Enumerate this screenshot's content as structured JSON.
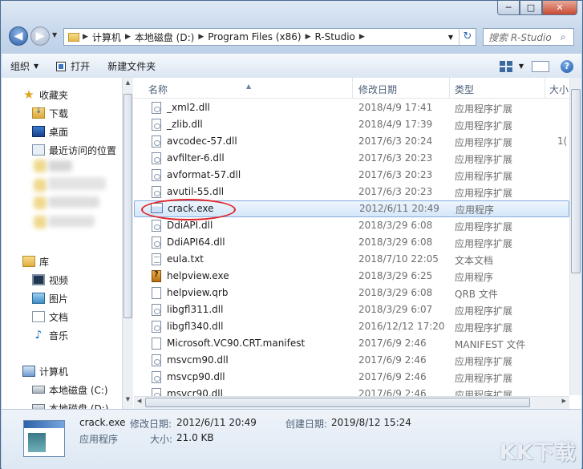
{
  "window": {
    "controls": [
      "─",
      "□",
      "✕"
    ]
  },
  "address": {
    "crumbs": [
      "计算机",
      "本地磁盘 (D:)",
      "Program Files (x86)",
      "R-Studio"
    ],
    "search_placeholder": "搜索 R-Studio"
  },
  "toolbar": {
    "organize": "组织",
    "open": "打开",
    "new_folder": "新建文件夹"
  },
  "nav": {
    "favorites": "收藏夹",
    "downloads": "下载",
    "desktop": "桌面",
    "recent": "最近访问的位置",
    "libraries": "库",
    "videos": "视频",
    "pictures": "图片",
    "documents": "文档",
    "music": "音乐",
    "computer": "计算机",
    "drive_c": "本地磁盘 (C:)",
    "drive_d": "本地磁盘 (D:)"
  },
  "columns": {
    "name": "名称",
    "modified": "修改日期",
    "type": "类型",
    "size": "大小"
  },
  "files": [
    {
      "name": "_xml2.dll",
      "date": "2018/4/9 17:41",
      "type": "应用程序扩展",
      "size": "",
      "icon": "dll-icon"
    },
    {
      "name": "_zlib.dll",
      "date": "2018/4/9 17:39",
      "type": "应用程序扩展",
      "size": "",
      "icon": "dll-icon"
    },
    {
      "name": "avcodec-57.dll",
      "date": "2017/6/3 20:24",
      "type": "应用程序扩展",
      "size": "1(",
      "icon": "dll-icon"
    },
    {
      "name": "avfilter-6.dll",
      "date": "2017/6/3 20:23",
      "type": "应用程序扩展",
      "size": "",
      "icon": "dll-icon"
    },
    {
      "name": "avformat-57.dll",
      "date": "2017/6/3 20:23",
      "type": "应用程序扩展",
      "size": "",
      "icon": "dll-icon"
    },
    {
      "name": "avutil-55.dll",
      "date": "2017/6/3 20:23",
      "type": "应用程序扩展",
      "size": "",
      "icon": "dll-icon"
    },
    {
      "name": "crack.exe",
      "date": "2012/6/11 20:49",
      "type": "应用程序",
      "size": "",
      "icon": "exe-icon"
    },
    {
      "name": "DdiAPI.dll",
      "date": "2018/3/29 6:08",
      "type": "应用程序扩展",
      "size": "",
      "icon": "dll-icon"
    },
    {
      "name": "DdiAPI64.dll",
      "date": "2018/3/29 6:08",
      "type": "应用程序扩展",
      "size": "",
      "icon": "dll-icon"
    },
    {
      "name": "eula.txt",
      "date": "2018/7/10 22:05",
      "type": "文本文档",
      "size": "",
      "icon": "txt-icon"
    },
    {
      "name": "helpview.exe",
      "date": "2018/3/29 6:25",
      "type": "应用程序",
      "size": "",
      "icon": "help-exe-icon"
    },
    {
      "name": "helpview.qrb",
      "date": "2018/3/29 6:08",
      "type": "QRB 文件",
      "size": "",
      "icon": "file-icon"
    },
    {
      "name": "libgfl311.dll",
      "date": "2018/3/29 6:07",
      "type": "应用程序扩展",
      "size": "",
      "icon": "dll-icon"
    },
    {
      "name": "libgfl340.dll",
      "date": "2016/12/12 17:20",
      "type": "应用程序扩展",
      "size": "",
      "icon": "dll-icon"
    },
    {
      "name": "Microsoft.VC90.CRT.manifest",
      "date": "2017/6/9 2:46",
      "type": "MANIFEST 文件",
      "size": "",
      "icon": "file-icon"
    },
    {
      "name": "msvcm90.dll",
      "date": "2017/6/9 2:46",
      "type": "应用程序扩展",
      "size": "",
      "icon": "dll-icon"
    },
    {
      "name": "msvcp90.dll",
      "date": "2017/6/9 2:46",
      "type": "应用程序扩展",
      "size": "",
      "icon": "dll-icon"
    },
    {
      "name": "msvcr90.dll",
      "date": "2017/6/9 2:46",
      "type": "应用程序扩展",
      "size": "",
      "icon": "dll-icon"
    }
  ],
  "selected_index": 6,
  "details": {
    "filename": "crack.exe",
    "modified_label": "修改日期:",
    "modified_value": "2012/6/11 20:49",
    "created_label": "创建日期:",
    "created_value": "2019/8/12 15:24",
    "type": "应用程序",
    "size_label": "大小:",
    "size_value": "21.0 KB"
  },
  "watermark": "KK下载",
  "colors": {
    "highlight_oval": "#e02427",
    "selection": "#d5e7fa"
  }
}
